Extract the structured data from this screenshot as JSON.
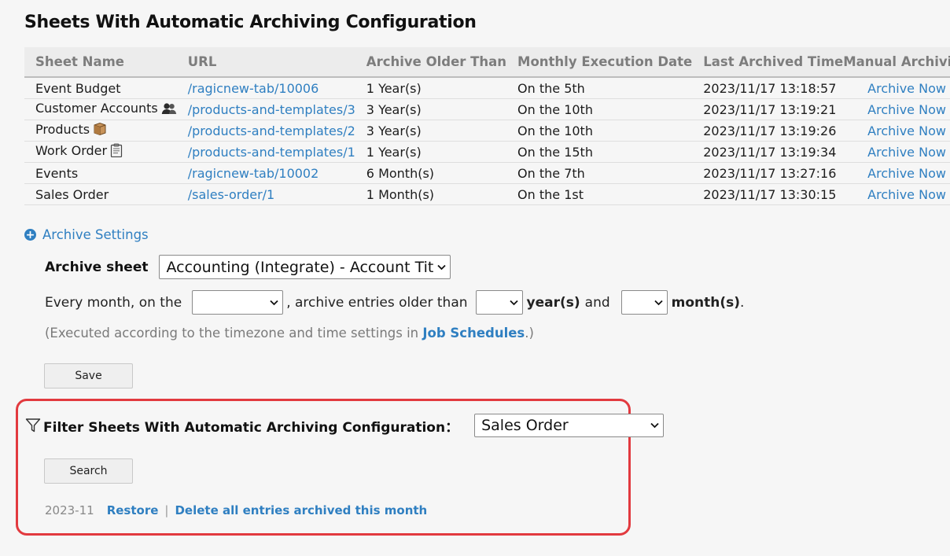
{
  "page": {
    "title": "Sheets With Automatic Archiving Configuration"
  },
  "table": {
    "columns": [
      "Sheet Name",
      "URL",
      "Archive Older Than",
      "Monthly Execution Date",
      "Last Archived Time",
      "Manual Archiving"
    ],
    "rows": [
      {
        "name": "Event Budget",
        "icon": "",
        "url": "/ragicnew-tab/10006",
        "older_than": "1 Year(s)",
        "exec_date": "On the 5th",
        "last_archived": "2023/11/17 13:18:57",
        "action": "Archive Now"
      },
      {
        "name": "Customer Accounts",
        "icon": "people-icon",
        "url": "/products-and-templates/3",
        "older_than": "3 Year(s)",
        "exec_date": "On the 10th",
        "last_archived": "2023/11/17 13:19:21",
        "action": "Archive Now"
      },
      {
        "name": "Products",
        "icon": "box-icon",
        "url": "/products-and-templates/2",
        "older_than": "3 Year(s)",
        "exec_date": "On the 10th",
        "last_archived": "2023/11/17 13:19:26",
        "action": "Archive Now"
      },
      {
        "name": "Work Order",
        "icon": "clipboard-icon",
        "url": "/products-and-templates/1",
        "older_than": "1 Year(s)",
        "exec_date": "On the 15th",
        "last_archived": "2023/11/17 13:19:34",
        "action": "Archive Now"
      },
      {
        "name": "Events",
        "icon": "",
        "url": "/ragicnew-tab/10002",
        "older_than": "6 Month(s)",
        "exec_date": "On the 7th",
        "last_archived": "2023/11/17 13:27:16",
        "action": "Archive Now"
      },
      {
        "name": "Sales Order",
        "icon": "",
        "url": "/sales-order/1",
        "older_than": "1 Month(s)",
        "exec_date": "On the 1st",
        "last_archived": "2023/11/17 13:30:15",
        "action": "Archive Now"
      }
    ]
  },
  "settings": {
    "toggle_label": "Archive Settings",
    "archive_sheet_label": "Archive sheet",
    "archive_sheet_value": "Accounting (Integrate) - Account Title",
    "every_month_text": "Every month, on the",
    "older_than_text": ", archive entries older than",
    "years_text": "year(s)",
    "and_text": "and",
    "months_text": "month(s)",
    "period": ".",
    "day_value": "",
    "years_value": "",
    "months_value": "",
    "note_prefix": "(Executed according to the timezone and time settings in ",
    "note_link": "Job Schedules",
    "note_suffix": ".)",
    "save_label": "Save"
  },
  "filter": {
    "label": "Filter Sheets With Automatic Archiving Configuration：",
    "selected": "Sales Order",
    "search_label": "Search",
    "month": "2023-11",
    "restore_label": "Restore",
    "separator": "|",
    "delete_label": "Delete all entries archived this month"
  },
  "colors": {
    "link": "#2f7fc1",
    "highlight_border": "#e23a3f",
    "background": "#f6f6f6"
  }
}
